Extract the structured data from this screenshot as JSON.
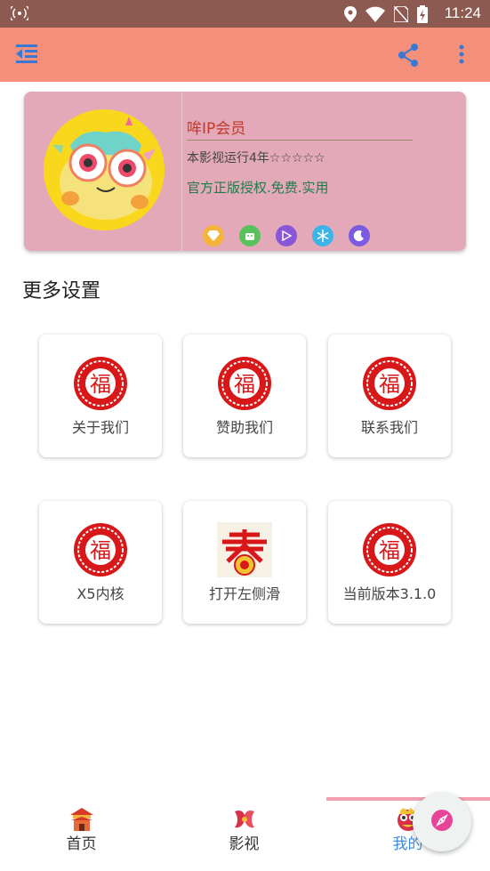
{
  "status_bar": {
    "time": "11:24"
  },
  "app_bar": {
    "menu_icon": "menu-collapse-icon",
    "share_icon": "share-icon",
    "more_icon": "more-vertical-icon"
  },
  "profile": {
    "member_title": "哞IP会员",
    "run_text": "本影视运行4年☆☆☆☆☆",
    "official_text": "官方正版授权.免费.实用",
    "badges": [
      {
        "name": "diamond-badge",
        "color": "#f4b43c"
      },
      {
        "name": "android-badge",
        "color": "#57c25a"
      },
      {
        "name": "play-badge",
        "color": "#8a56d8"
      },
      {
        "name": "snowflake-badge",
        "color": "#3cb4e8"
      },
      {
        "name": "moon-badge",
        "color": "#7b5be0"
      }
    ]
  },
  "section": {
    "title": "更多设置"
  },
  "tiles": [
    {
      "label": "关于我们",
      "icon": "fu-icon"
    },
    {
      "label": "赞助我们",
      "icon": "fu-icon"
    },
    {
      "label": "联系我们",
      "icon": "fu-icon"
    },
    {
      "label": "X5内核",
      "icon": "fu-icon"
    },
    {
      "label": "打开左侧滑",
      "icon": "chun-icon"
    },
    {
      "label": "当前版本3.1.0",
      "icon": "fu-icon"
    }
  ],
  "bottom_nav": {
    "items": [
      {
        "label": "首页",
        "icon": "palace-icon"
      },
      {
        "label": "影视",
        "icon": "fish-icon"
      },
      {
        "label": "我的",
        "icon": "lion-dance-icon"
      }
    ],
    "active_index": 2
  },
  "fab": {
    "icon": "compass-icon"
  },
  "colors": {
    "status_bar": "#8c5a50",
    "app_bar": "#f4907a",
    "card": "#e3a9b9",
    "active_tab": "#3b8de0"
  }
}
